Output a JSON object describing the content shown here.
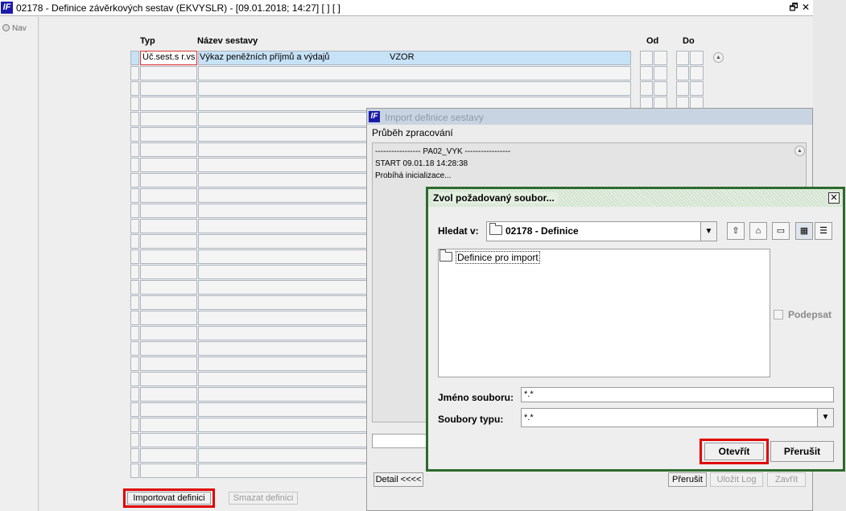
{
  "window": {
    "logo_text": "IF",
    "title": "02178 - Definice závěrkových sestav (EKVYSLR) - [09.01.2018; 14:27]  [ ]  [ ]",
    "restore_glyph": "🗗",
    "close_glyph": "✕"
  },
  "nav": {
    "label": "Nav"
  },
  "grid": {
    "headers": {
      "typ": "Typ",
      "nazev": "Název sestavy",
      "od": "Od",
      "do": "Do"
    },
    "selected_row": {
      "typ": "Úč.sest.s r.vs",
      "nazev": "Výkaz peněžních příjmů a výdajů",
      "tag": "VZOR"
    },
    "row_count": 30
  },
  "buttons": {
    "import": "Importovat definici",
    "delete": "Smazat definici"
  },
  "import_dialog": {
    "title": "Import definice sestavy",
    "section": "Průběh zpracování",
    "log_lines": [
      "----------------- PA02_VYK -----------------",
      "START 09.01.18 14:28:38",
      "Probíhá inicializace..."
    ],
    "detail": "Detail <<<<",
    "interrupt": "Přerušit",
    "save_log": "Uložit Log",
    "close": "Zavřít"
  },
  "chooser": {
    "title": "Zvol požadovaný soubor...",
    "look_in_label": "Hledat v:",
    "look_in_value": "02178 - Definice",
    "items": [
      "Definice pro import"
    ],
    "sign_label": "Podepsat",
    "filename_label": "Jméno souboru:",
    "filename_value": "*.*",
    "filetype_label": "Soubory typu:",
    "filetype_value": "*.*",
    "open": "Otevřít",
    "cancel": "Přerušit"
  }
}
